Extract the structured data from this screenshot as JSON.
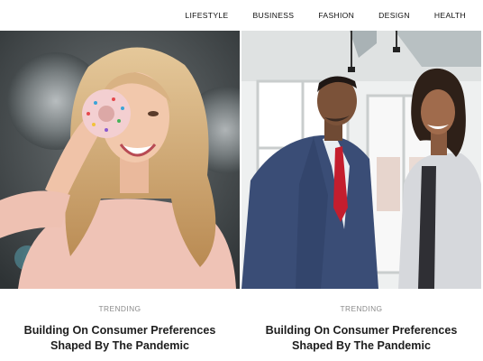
{
  "nav": {
    "items": [
      {
        "label": "LIFESTYLE"
      },
      {
        "label": "BUSINESS"
      },
      {
        "label": "FASHION"
      },
      {
        "label": "DESIGN"
      },
      {
        "label": "HEALTH"
      }
    ]
  },
  "cards": [
    {
      "category": "TRENDING",
      "title": "Building On Consumer Preferences Shaped By The Pandemic",
      "image_icon": "woman-holding-donut-photo"
    },
    {
      "category": "TRENDING",
      "title": "Building On Consumer Preferences Shaped By The Pandemic",
      "image_icon": "business-people-office-photo"
    }
  ]
}
